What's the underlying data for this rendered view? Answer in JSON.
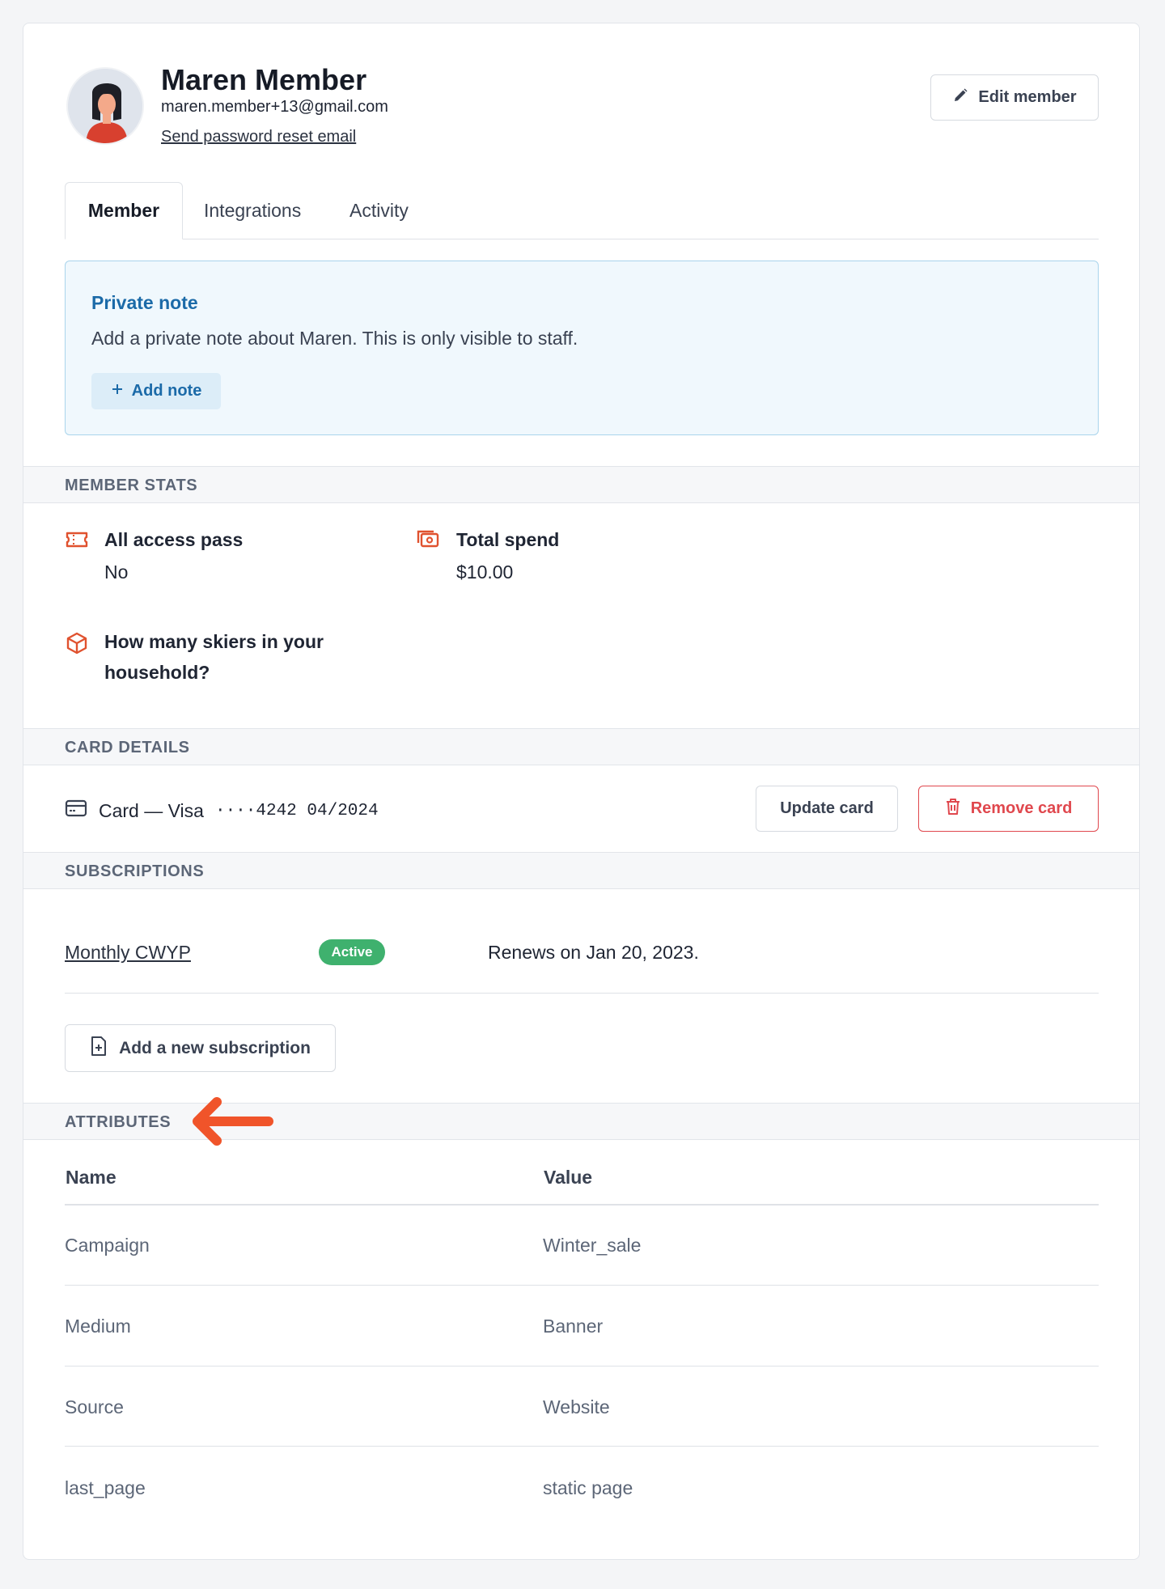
{
  "member": {
    "name": "Maren Member",
    "email": "maren.member+13@gmail.com",
    "reset_link": "Send password reset email",
    "edit_label": "Edit member"
  },
  "tabs": [
    {
      "label": "Member",
      "active": true
    },
    {
      "label": "Integrations",
      "active": false
    },
    {
      "label": "Activity",
      "active": false
    }
  ],
  "note": {
    "title": "Private note",
    "description": "Add a private note about Maren. This is only visible to staff.",
    "add_label": "Add note"
  },
  "stats": {
    "heading": "MEMBER STATS",
    "items": [
      {
        "icon": "ticket-icon",
        "label": "All access pass",
        "value": "No"
      },
      {
        "icon": "money-icon",
        "label": "Total spend",
        "value": "$10.00"
      },
      {
        "icon": "box-icon",
        "label": "How many skiers in your household?",
        "value": ""
      }
    ]
  },
  "card_details": {
    "heading": "CARD DETAILS",
    "label": "Card — Visa",
    "number": "····4242 04/2024",
    "update_label": "Update card",
    "remove_label": "Remove card"
  },
  "subscriptions": {
    "heading": "SUBSCRIPTIONS",
    "items": [
      {
        "name": "Monthly CWYP",
        "status": "Active",
        "renews_prefix": "Renews on ",
        "renews_date": "Jan 20, 2023."
      }
    ],
    "add_label": "Add a new subscription"
  },
  "attributes": {
    "heading": "ATTRIBUTES",
    "columns": [
      "Name",
      "Value"
    ],
    "rows": [
      {
        "name": "Campaign",
        "value": "Winter_sale"
      },
      {
        "name": "Medium",
        "value": "Banner"
      },
      {
        "name": "Source",
        "value": "Website"
      },
      {
        "name": "last_page",
        "value": "static page"
      }
    ]
  },
  "colors": {
    "accent_blue": "#1b6aa8",
    "danger": "#e0484e",
    "success": "#3fb16e",
    "icon_orange": "#e0522f",
    "annotation_arrow": "#f0542a"
  }
}
